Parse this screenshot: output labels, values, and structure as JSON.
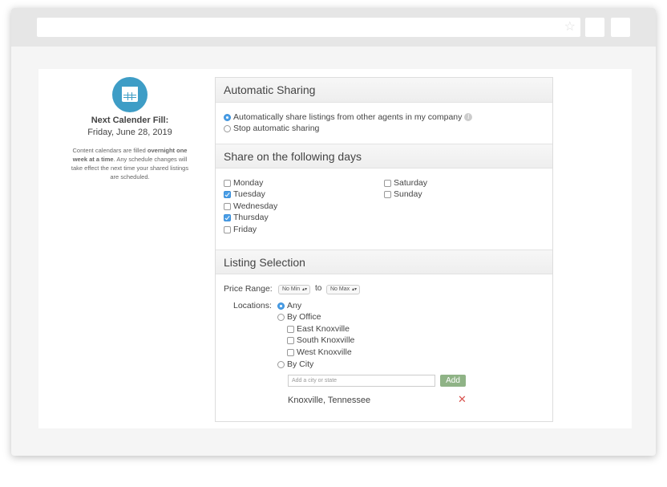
{
  "calendar": {
    "next_label": "Next Calender Fill:",
    "next_date": "Friday, June 28, 2019",
    "note_prefix": "Content calendars are filled ",
    "note_bold": "overnight one week at a time",
    "note_suffix": ". Any schedule changes will take effect the next time your shared listings are scheduled."
  },
  "automatic_sharing": {
    "title": "Automatic Sharing",
    "options": [
      {
        "label": "Automatically share listings from other agents in my company",
        "selected": true
      },
      {
        "label": "Stop automatic sharing",
        "selected": false
      }
    ]
  },
  "days": {
    "title": "Share on the following days",
    "items": [
      {
        "label": "Monday",
        "checked": false
      },
      {
        "label": "Tuesday",
        "checked": true
      },
      {
        "label": "Wednesday",
        "checked": false
      },
      {
        "label": "Thursday",
        "checked": true
      },
      {
        "label": "Friday",
        "checked": false
      },
      {
        "label": "Saturday",
        "checked": false
      },
      {
        "label": "Sunday",
        "checked": false
      }
    ]
  },
  "listing_selection": {
    "title": "Listing Selection",
    "price_label": "Price Range:",
    "min_value": "No Min",
    "to_label": "to",
    "max_value": "No Max",
    "locations_label": "Locations:",
    "any_label": "Any",
    "by_office_label": "By Office",
    "offices": [
      "East Knoxville",
      "South Knoxville",
      "West Knoxville"
    ],
    "by_city_label": "By City",
    "city_placeholder": "Add a city or state",
    "add_label": "Add",
    "cities": [
      "Knoxville, Tennessee"
    ]
  },
  "colors": {
    "accent": "#3e9dc6",
    "add_button": "#8fb386",
    "remove": "#d9534f"
  }
}
